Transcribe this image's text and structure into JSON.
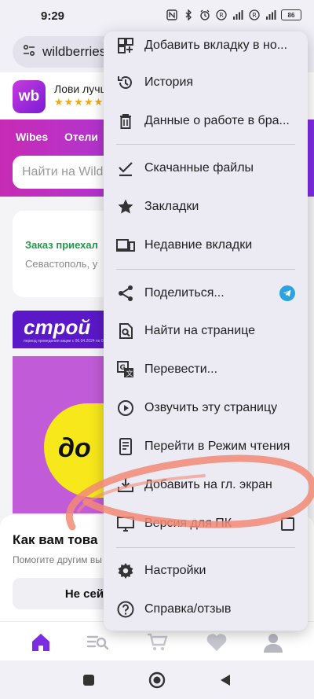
{
  "status_bar": {
    "time": "9:29",
    "battery": "86"
  },
  "url_bar": {
    "url": "wildberries."
  },
  "page": {
    "banner": {
      "logo": "wb",
      "title": "Лови лучш",
      "stars": "★★★★★"
    },
    "nav_links": [
      "Wibes",
      "Отели"
    ],
    "search_placeholder": "Найти на Wild",
    "order_card": {
      "title": "Заказ приехал",
      "subtitle": "Севастополь, у"
    },
    "promo": {
      "word": "строй",
      "note": "период проведения акции с 06.04.2024 по 03.05.2024",
      "word2": "до"
    },
    "rate_panel": {
      "title": "Как вам това",
      "subtitle": "Помогите другим вы",
      "button": "Не сейча"
    }
  },
  "menu": {
    "items": [
      {
        "id": "add-tab",
        "label": "Добавить вкладку в но...",
        "icon": "add-tab-icon"
      },
      {
        "id": "history",
        "label": "История",
        "icon": "history-icon"
      },
      {
        "id": "clear-data",
        "label": "Данные о работе в бра...",
        "icon": "trash-icon"
      },
      {
        "id": "downloads",
        "label": "Скачанные файлы",
        "icon": "download-check-icon"
      },
      {
        "id": "bookmarks",
        "label": "Закладки",
        "icon": "star-icon"
      },
      {
        "id": "recent-tabs",
        "label": "Недавние вкладки",
        "icon": "devices-icon"
      },
      {
        "id": "share",
        "label": "Поделиться...",
        "icon": "share-icon"
      },
      {
        "id": "find",
        "label": "Найти на странице",
        "icon": "find-in-page-icon"
      },
      {
        "id": "translate",
        "label": "Перевести...",
        "icon": "translate-icon"
      },
      {
        "id": "read-aloud",
        "label": "Озвучить эту страницу",
        "icon": "play-circle-icon"
      },
      {
        "id": "reader-mode",
        "label": "Перейти в Режим чтения",
        "icon": "reader-mode-icon"
      },
      {
        "id": "add-home",
        "label": "Добавить на гл. экран",
        "icon": "add-to-home-icon"
      },
      {
        "id": "desktop",
        "label": "Версия для ПК",
        "icon": "monitor-icon"
      },
      {
        "id": "settings",
        "label": "Настройки",
        "icon": "gear-icon"
      },
      {
        "id": "help",
        "label": "Справка/отзыв",
        "icon": "help-icon"
      }
    ],
    "desktop_checked": false
  },
  "colors": {
    "accent_purple": "#7d2ce5",
    "menu_bg": "#eceaf3",
    "telegram_blue": "#2aa3e0",
    "scribble": "#f28a76"
  }
}
